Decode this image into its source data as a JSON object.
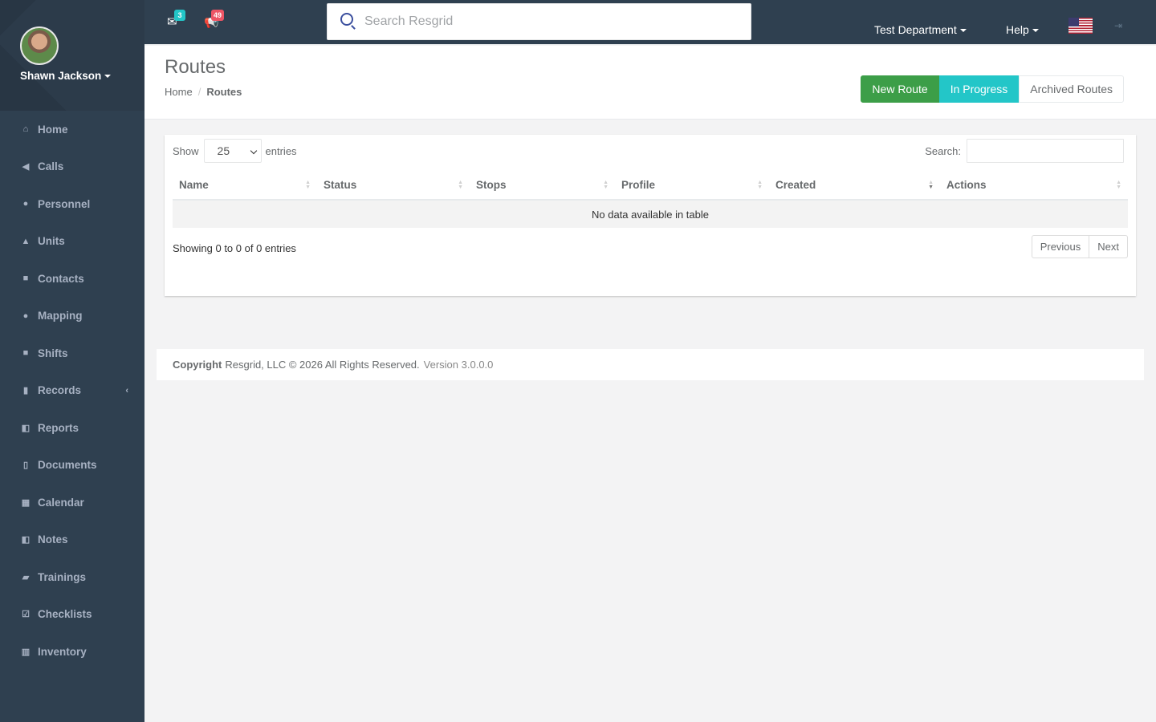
{
  "user": {
    "name": "Shawn Jackson"
  },
  "sidebar": {
    "items": [
      {
        "label": "Home",
        "icon": "home-icon",
        "glyph": "⌂"
      },
      {
        "label": "Calls",
        "icon": "bullhorn-icon",
        "glyph": "◀"
      },
      {
        "label": "Personnel",
        "icon": "user-icon",
        "glyph": "●"
      },
      {
        "label": "Units",
        "icon": "truck-icon",
        "glyph": "▲"
      },
      {
        "label": "Contacts",
        "icon": "address-book-icon",
        "glyph": "■"
      },
      {
        "label": "Mapping",
        "icon": "map-marker-icon",
        "glyph": "●"
      },
      {
        "label": "Shifts",
        "icon": "briefcase-icon",
        "glyph": "■"
      },
      {
        "label": "Records",
        "icon": "file-icon",
        "glyph": "▮"
      },
      {
        "label": "Reports",
        "icon": "reports-icon",
        "glyph": "◧"
      },
      {
        "label": "Documents",
        "icon": "document-icon",
        "glyph": "▯"
      },
      {
        "label": "Calendar",
        "icon": "calendar-icon",
        "glyph": "▦"
      },
      {
        "label": "Notes",
        "icon": "notes-icon",
        "glyph": "◧"
      },
      {
        "label": "Trainings",
        "icon": "book-icon",
        "glyph": "▰"
      },
      {
        "label": "Checklists",
        "icon": "check-square-icon",
        "glyph": "☑"
      },
      {
        "label": "Inventory",
        "icon": "barcode-icon",
        "glyph": "▥"
      }
    ]
  },
  "topbar": {
    "messages_count": "3",
    "calls_count": "49",
    "search_placeholder": "Search Resgrid",
    "department": "Test Department",
    "help": "Help"
  },
  "header": {
    "title": "Routes",
    "breadcrumb_home": "Home",
    "breadcrumb_current": "Routes",
    "buttons": {
      "new_route": "New Route",
      "in_progress": "In Progress",
      "archived": "Archived Routes"
    }
  },
  "table": {
    "show_label": "Show",
    "entries_label": "entries",
    "page_length": "25",
    "search_label": "Search:",
    "columns": [
      "Name",
      "Status",
      "Stops",
      "Profile",
      "Created",
      "Actions"
    ],
    "empty_message": "No data available in table",
    "info": "Showing 0 to 0 of 0 entries",
    "prev_label": "Previous",
    "next_label": "Next"
  },
  "footer": {
    "copyright_label": "Copyright",
    "copyright_text": "Resgrid, LLC © 2026 All Rights Reserved.",
    "version": "Version 3.0.0.0"
  },
  "colors": {
    "sidebar_bg": "#2f4050",
    "primary_green": "#3c9e48",
    "teal": "#23c6c8",
    "badge_red": "#ed5565"
  }
}
